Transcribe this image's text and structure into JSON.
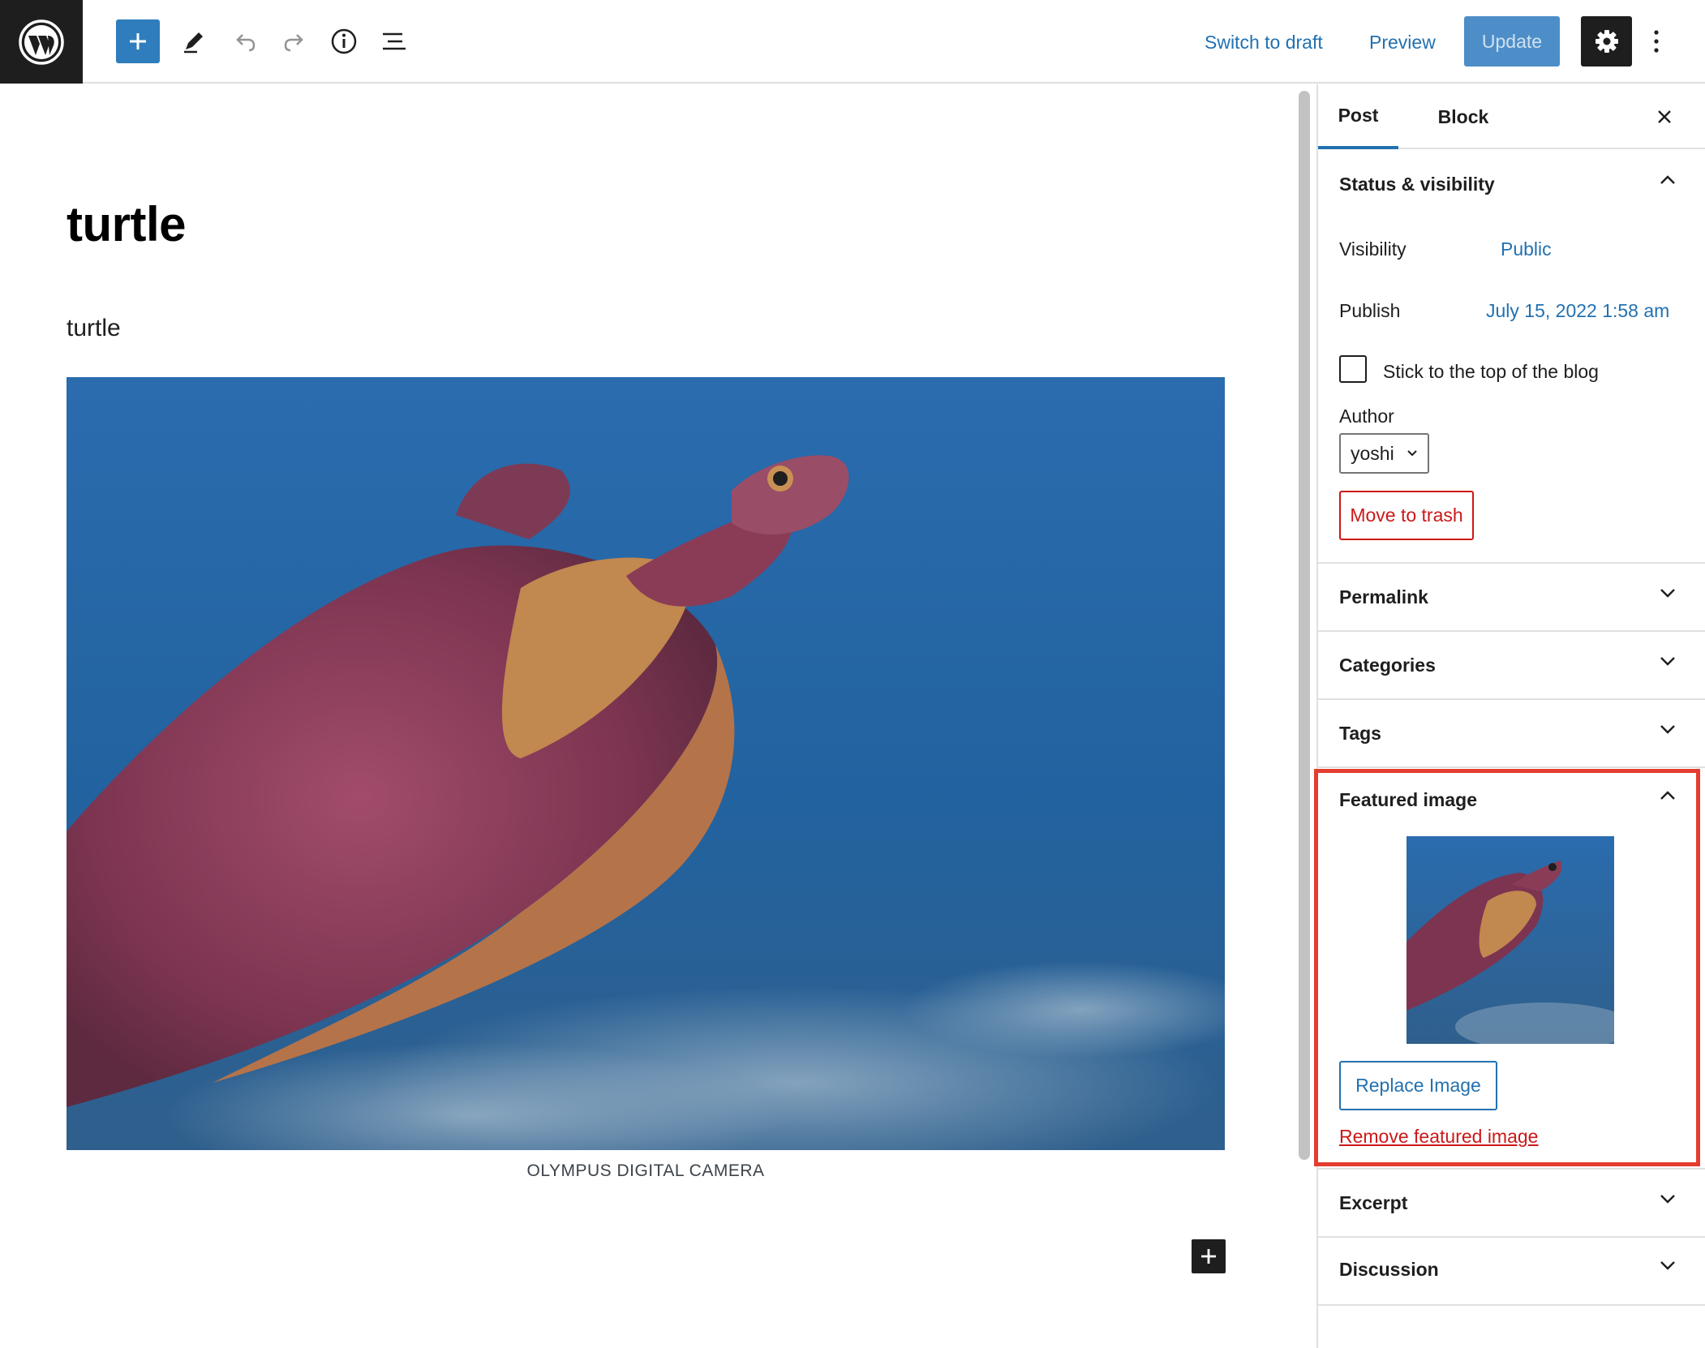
{
  "topbar": {
    "logo_icon": "wordpress-logo-icon",
    "tools": [
      "add-block-icon",
      "pencil-icon",
      "undo-icon",
      "redo-icon",
      "info-icon",
      "list-view-icon"
    ],
    "switch_to_draft": "Switch to draft",
    "preview": "Preview",
    "update": "Update",
    "settings_icon": "gear-icon",
    "more_icon": "more-vertical-icon"
  },
  "editor": {
    "title": "turtle",
    "paragraph": "turtle",
    "image_caption": "OLYMPUS DIGITAL CAMERA"
  },
  "sidebar": {
    "tabs": [
      {
        "label": "Post",
        "active": true
      },
      {
        "label": "Block",
        "active": false
      }
    ],
    "status_visibility": {
      "title": "Status & visibility",
      "expanded": true,
      "visibility_label": "Visibility",
      "visibility_value": "Public",
      "publish_label": "Publish",
      "publish_value": "July 15, 2022 1:58 am",
      "sticky_label": "Stick to the top of the blog",
      "sticky_checked": false,
      "author_label": "Author",
      "author_value": "yoshi",
      "trash_label": "Move to trash"
    },
    "panels": {
      "permalink": "Permalink",
      "categories": "Categories",
      "tags": "Tags",
      "featured_image": "Featured image",
      "excerpt": "Excerpt",
      "discussion": "Discussion"
    },
    "featured_image": {
      "replace_label": "Replace Image",
      "remove_label": "Remove featured image"
    }
  },
  "colors": {
    "accent": "#2271b1",
    "destructive": "#cc1818",
    "highlight": "#e43d30",
    "toolbar_dark": "#1e1e1e"
  }
}
